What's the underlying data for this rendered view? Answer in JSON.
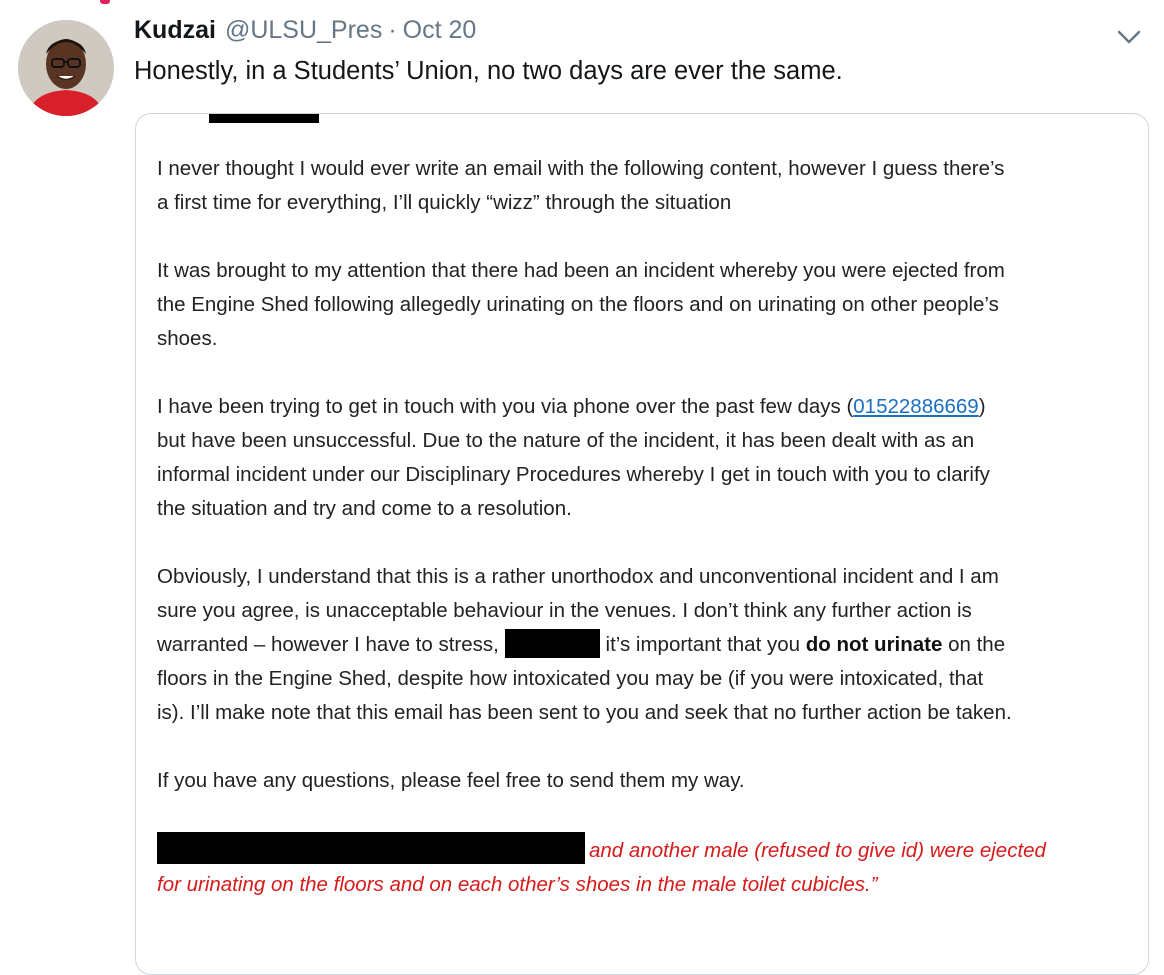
{
  "tweet": {
    "author_name": "Kudzai",
    "handle": "@ULSU_Pres",
    "separator": "·",
    "date": "Oct 20",
    "text": "Honestly, in a Students’ Union, no two days are ever the same.",
    "menu_icon": "chevron-down-icon"
  },
  "email": {
    "para1": {
      "line1": "I never thought I would ever write an email with the following content, however I guess there’s",
      "line2": "a first time for everything, I’ll quickly “wizz” through the situation"
    },
    "para2": {
      "line1": "It was brought to my attention that there had been an incident whereby you were ejected from",
      "line2": "the Engine Shed following allegedly urinating on the floors and on urinating on other people’s",
      "line3": "shoes."
    },
    "para3": {
      "line1_before": "I have been trying to get in touch with you via phone over the past few days (",
      "phone": "01522886669",
      "line1_after": ")",
      "line2": "but have been unsuccessful. Due to the nature of the incident, it has been dealt with as an",
      "line3": "informal incident under our Disciplinary Procedures whereby I get in touch with you to clarify",
      "line4": "the situation and try and come to a resolution."
    },
    "para4": {
      "line1": "Obviously, I understand that this is a rather unorthodox and unconventional incident and I am",
      "line2": "sure you agree, is unacceptable behaviour in the venues. I don’t think any further action is",
      "line3_before": "warranted – however I have to stress,",
      "line3_middle": "it’s important that you",
      "line3_bold": "do not urinate",
      "line3_after": "on the",
      "line4": "floors in the Engine Shed, despite how intoxicated you may be (if you were intoxicated, that",
      "line5": "is). I’ll make note that this email has been sent to you and seek that no further action be taken."
    },
    "para5": {
      "line1": "If you have any questions, please feel free to send them my way."
    },
    "quote": {
      "line1": "and another male (refused to give id) were ejected",
      "line2": "for urinating on the floors and on each other’s shoes in the male toilet cubicles.”"
    }
  },
  "colors": {
    "link": "#1a6fc1",
    "quote_red": "#d71a1a",
    "secondary_text": "#657786",
    "avatar_shirt": "#d8202a"
  }
}
